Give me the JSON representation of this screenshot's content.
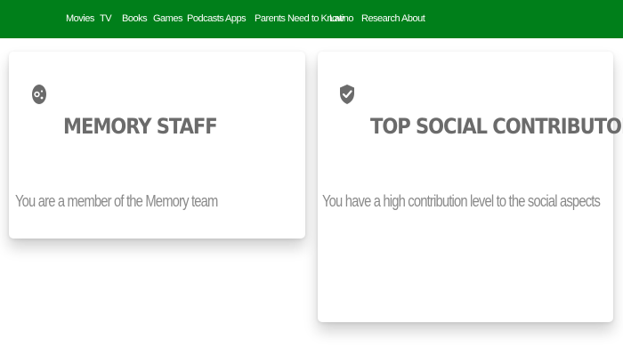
{
  "nav": {
    "items": [
      {
        "label": "Movies"
      },
      {
        "label": "TV"
      },
      {
        "label": "Books"
      },
      {
        "label": "Games"
      },
      {
        "label": "Podcasts"
      },
      {
        "label": "Apps"
      },
      {
        "label": "Parents Need to Know"
      },
      {
        "label": "Latino"
      },
      {
        "label": "Research"
      },
      {
        "label": "About"
      }
    ]
  },
  "badges": [
    {
      "title": "MEMORY STAFF",
      "description": "You are a member of the Memory team",
      "icon": "memory-staff-icon"
    },
    {
      "title": "TOP SOCIAL CONTRIBUTOR",
      "description": "You have a high contribution level to the social aspects",
      "icon": "shield-check-icon"
    }
  ],
  "colors": {
    "nav_bg": "#007f1a",
    "nav_text": "#ffffff",
    "title_text": "#6b6b6b",
    "desc_text": "#8a8a8a",
    "icon": "#6b6b6b"
  }
}
